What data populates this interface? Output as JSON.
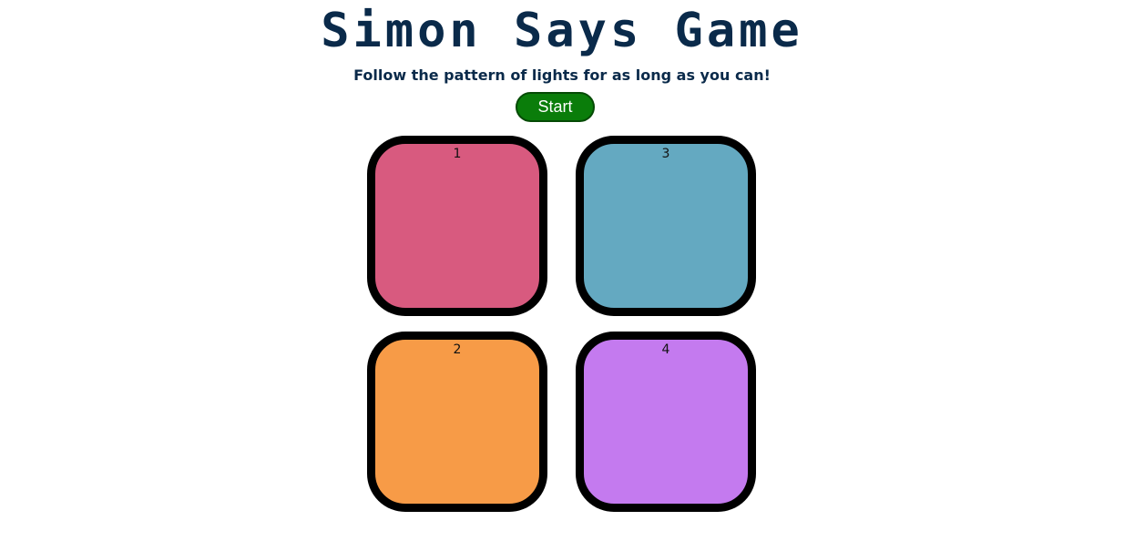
{
  "header": {
    "title": "Simon Says Game",
    "subtitle": "Follow the pattern of lights for as long as you can!"
  },
  "controls": {
    "start_label": "Start",
    "start_color": "#0a7d0a"
  },
  "pads": [
    {
      "label": "1",
      "color": "#d85a7f"
    },
    {
      "label": "3",
      "color": "#64a9c1"
    },
    {
      "label": "2",
      "color": "#f79b47"
    },
    {
      "label": "4",
      "color": "#c47aef"
    }
  ]
}
